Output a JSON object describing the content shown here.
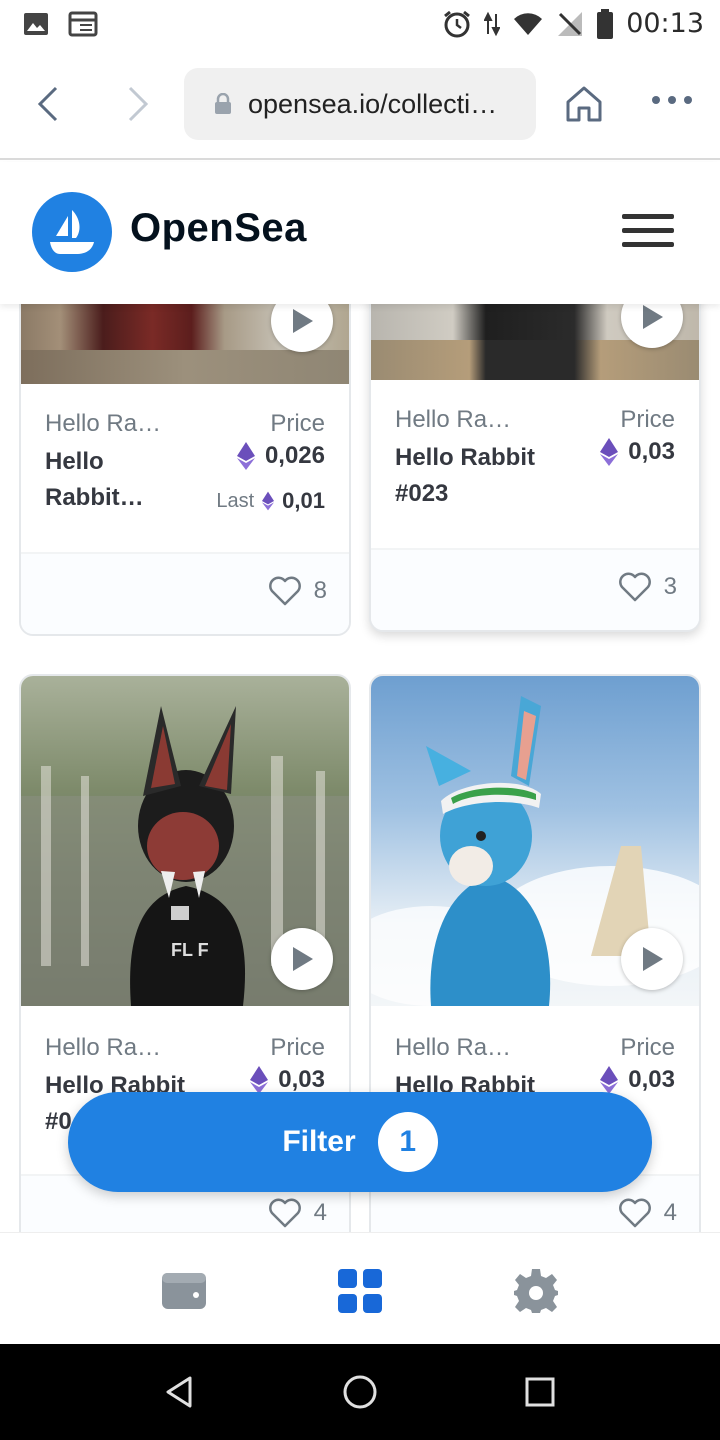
{
  "status_bar": {
    "time": "00:13",
    "left_icons": [
      "image-icon",
      "calendar-icon"
    ],
    "right_icons": [
      "alarm-icon",
      "data-arrows-icon",
      "wifi-icon",
      "no-signal-icon",
      "battery-icon"
    ]
  },
  "browser": {
    "url": "opensea.io/collecti…",
    "icons": [
      "back-icon",
      "forward-icon",
      "lock-icon",
      "home-icon",
      "more-icon"
    ]
  },
  "header": {
    "brand": "OpenSea",
    "icons": [
      "opensea-logo-icon",
      "hamburger-menu-icon"
    ]
  },
  "cards": [
    {
      "collection": "Hello Ra…",
      "price_label": "Price",
      "name_line1": "Hello",
      "name_line2": "Rabbit…",
      "price": "0,026",
      "last_label": "Last",
      "last_price": "0,01",
      "likes": "8"
    },
    {
      "collection": "Hello Ra…",
      "price_label": "Price",
      "name_line1": "Hello Rabbit",
      "name_line2": "#023",
      "price": "0,03",
      "likes": "3"
    },
    {
      "collection": "Hello Ra…",
      "price_label": "Price",
      "name_line1": "Hello Rabbit",
      "name_line2": "#0",
      "price": "0,03",
      "likes": "4"
    },
    {
      "collection": "Hello Ra…",
      "price_label": "Price",
      "name_line1": "Hello Rabbit",
      "name_line2": "",
      "price": "0,03",
      "likes": "4"
    }
  ],
  "filter": {
    "label": "Filter",
    "count": "1"
  },
  "bottom_nav": {
    "items": [
      "wallet-icon",
      "grid-icon",
      "settings-icon"
    ],
    "active_color": "#2081e2",
    "inactive_color": "#8a939b"
  },
  "system_nav": {
    "items": [
      "back-triangle-icon",
      "home-circle-icon",
      "recents-square-icon"
    ]
  },
  "colors": {
    "accent": "#2081e2",
    "eth": "#6b4fbb"
  }
}
